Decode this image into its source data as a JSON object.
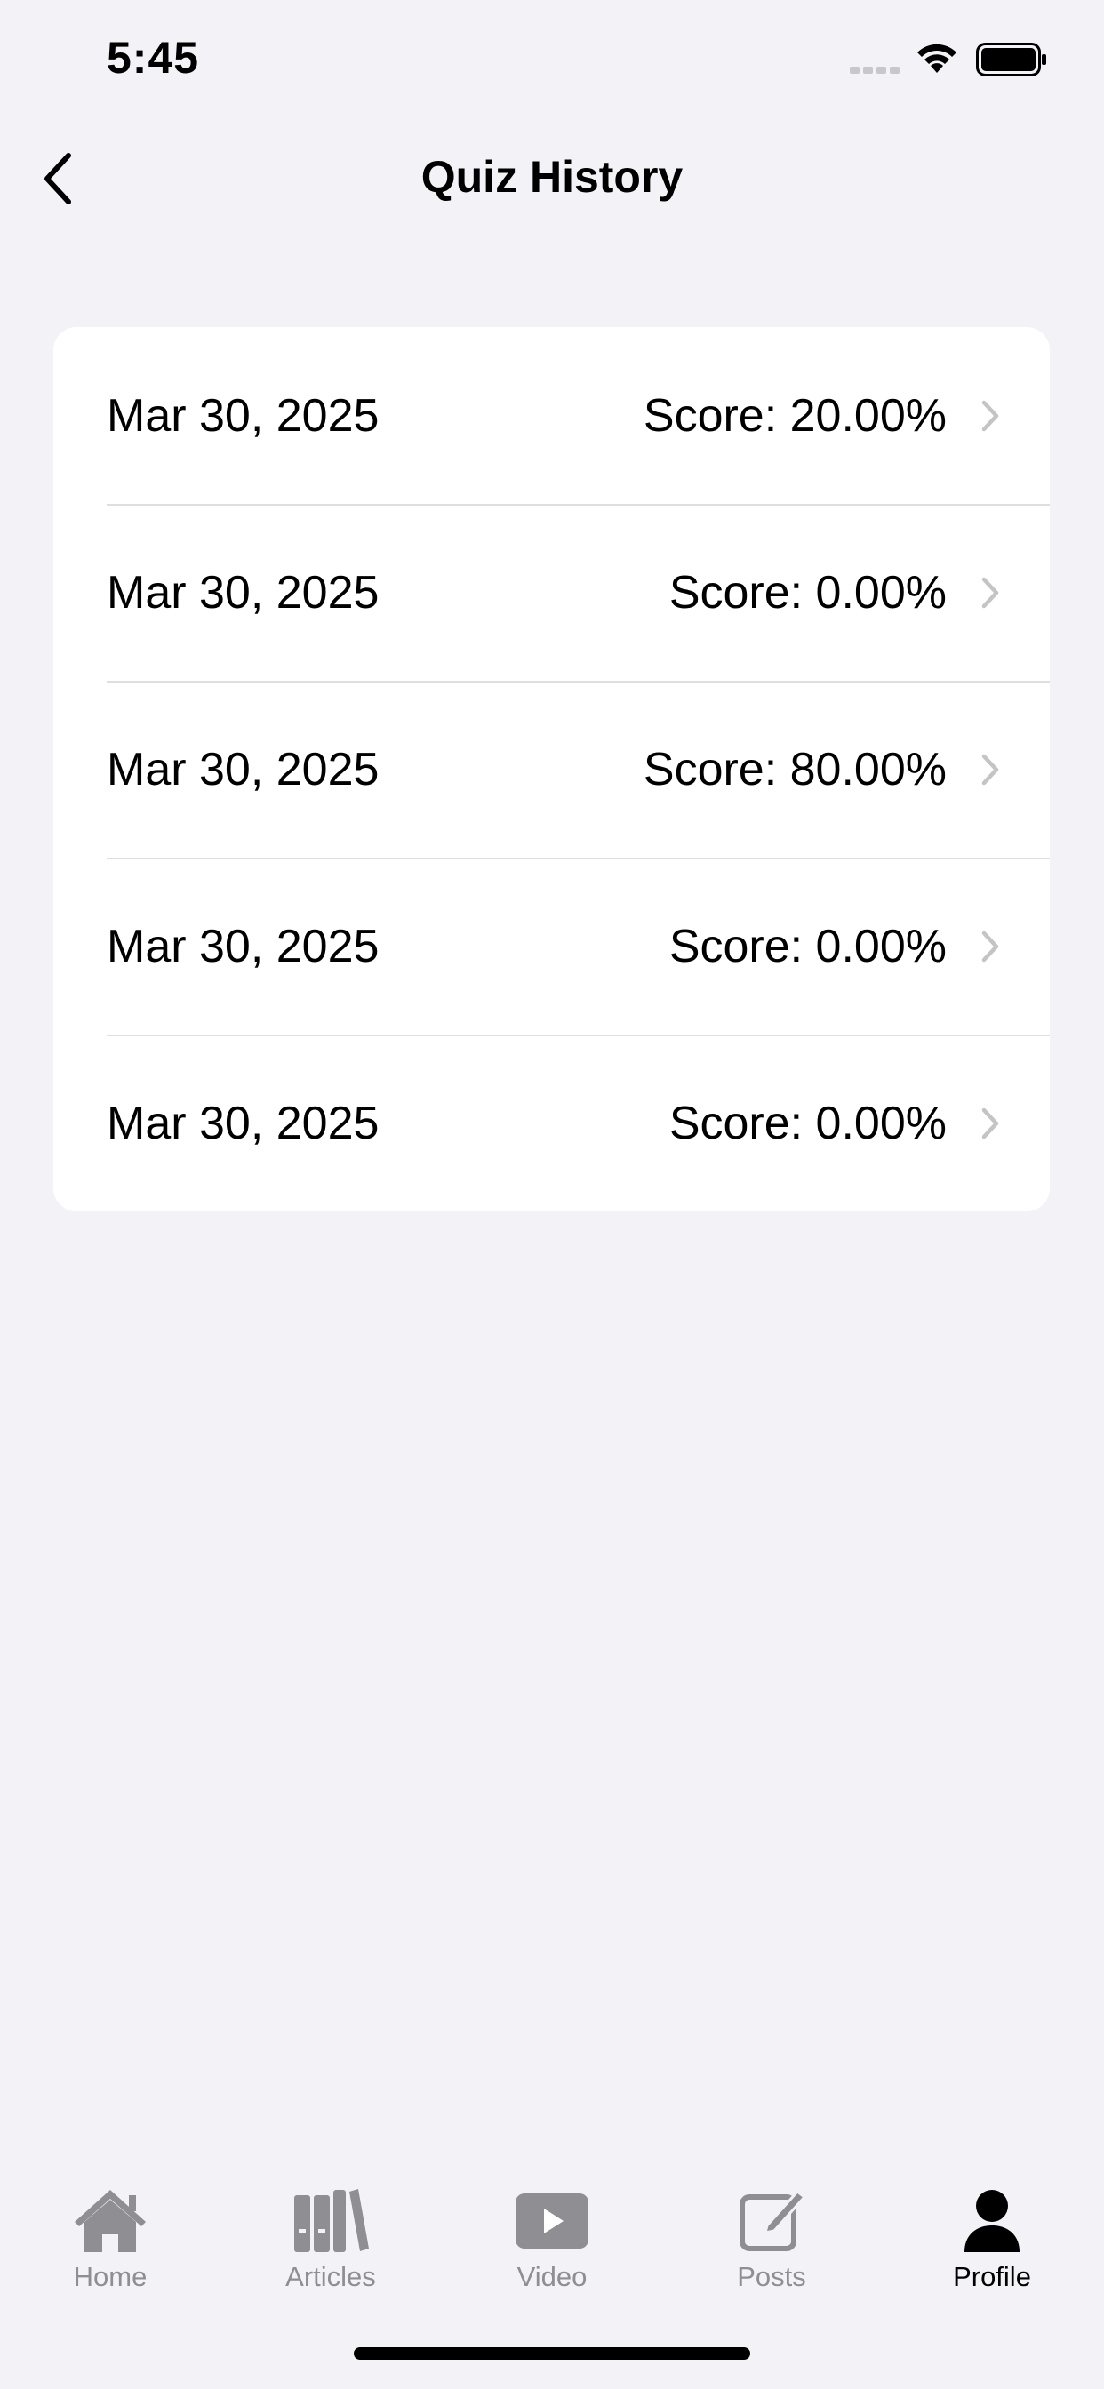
{
  "status_bar": {
    "time": "5:45",
    "icons": [
      "signal-icon",
      "wifi-icon",
      "battery-icon"
    ]
  },
  "nav": {
    "title": "Quiz History",
    "back_icon": "chevron-left-icon"
  },
  "quiz_history": [
    {
      "date": "Mar 30, 2025",
      "score": "Score: 20.00%"
    },
    {
      "date": "Mar 30, 2025",
      "score": "Score: 0.00%"
    },
    {
      "date": "Mar 30, 2025",
      "score": "Score: 80.00%"
    },
    {
      "date": "Mar 30, 2025",
      "score": "Score: 0.00%"
    },
    {
      "date": "Mar 30, 2025",
      "score": "Score: 0.00%"
    }
  ],
  "tab_bar": {
    "items": [
      {
        "label": "Home",
        "icon": "home-icon",
        "active": false
      },
      {
        "label": "Articles",
        "icon": "books-icon",
        "active": false
      },
      {
        "label": "Video",
        "icon": "play-icon",
        "active": false
      },
      {
        "label": "Posts",
        "icon": "compose-icon",
        "active": false
      },
      {
        "label": "Profile",
        "icon": "person-icon",
        "active": true
      }
    ]
  },
  "colors": {
    "background": "#f2f2f7",
    "card": "#ffffff",
    "separator": "#dedee3",
    "chevron": "#c4c4c7",
    "tab_inactive": "#8e8e93",
    "tab_active": "#000000"
  }
}
